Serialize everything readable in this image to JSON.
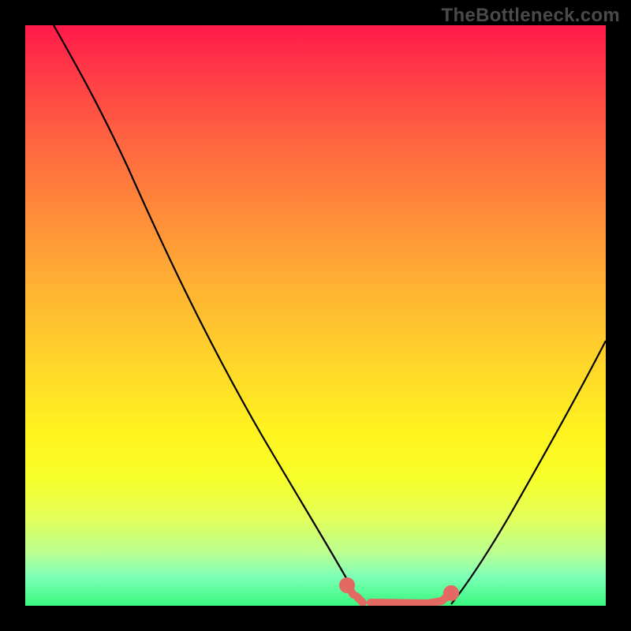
{
  "watermark": "TheBottleneck.com",
  "chart_data": {
    "type": "line",
    "title": "",
    "xlabel": "",
    "ylabel": "",
    "series": [
      {
        "name": "left-descending-curve",
        "color": "#000000",
        "points": [
          {
            "x": 0.05,
            "y": 1.0
          },
          {
            "x": 0.12,
            "y": 0.88
          },
          {
            "x": 0.2,
            "y": 0.7
          },
          {
            "x": 0.3,
            "y": 0.48
          },
          {
            "x": 0.4,
            "y": 0.28
          },
          {
            "x": 0.48,
            "y": 0.12
          },
          {
            "x": 0.54,
            "y": 0.04
          },
          {
            "x": 0.57,
            "y": 0.01
          }
        ]
      },
      {
        "name": "right-ascending-curve",
        "color": "#000000",
        "points": [
          {
            "x": 0.73,
            "y": 0.01
          },
          {
            "x": 0.78,
            "y": 0.06
          },
          {
            "x": 0.85,
            "y": 0.18
          },
          {
            "x": 0.92,
            "y": 0.32
          },
          {
            "x": 1.0,
            "y": 0.48
          }
        ]
      },
      {
        "name": "green-floor-band",
        "color": "#39f87e",
        "y": 0.0
      },
      {
        "name": "bottom-red-markers",
        "color": "#e36a63",
        "points": [
          {
            "x": 0.555,
            "y": 0.025
          },
          {
            "x": 0.565,
            "y": 0.012
          },
          {
            "x": 0.6,
            "y": 0.003
          },
          {
            "x": 0.64,
            "y": 0.003
          },
          {
            "x": 0.68,
            "y": 0.003
          },
          {
            "x": 0.705,
            "y": 0.005
          },
          {
            "x": 0.72,
            "y": 0.01
          },
          {
            "x": 0.73,
            "y": 0.018
          }
        ]
      }
    ]
  }
}
